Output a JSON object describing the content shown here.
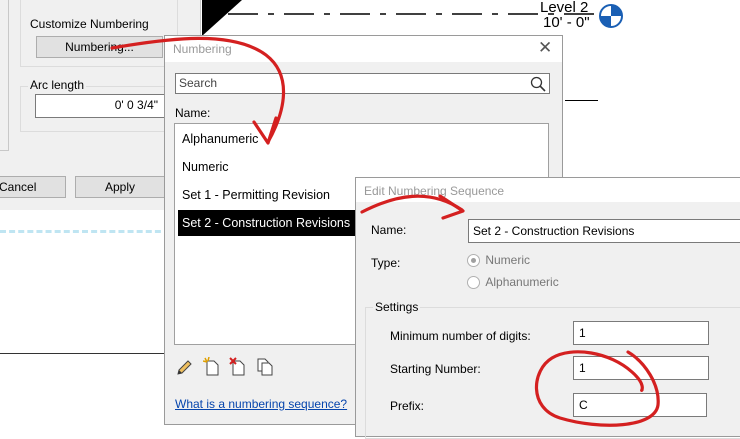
{
  "background_dialog": {
    "customize_numbering_label": "Customize Numbering",
    "numbering_button_label": "Numbering...",
    "arc_length_label": "Arc length",
    "arc_length_value": "0'  0 3/4\"",
    "cancel_label": "Cancel",
    "apply_label": "Apply"
  },
  "drawing": {
    "level_name": "Level 2",
    "level_elevation": "10' - 0\""
  },
  "numbering_dialog": {
    "title": "Numbering",
    "search_placeholder": "Search",
    "name_label": "Name:",
    "items": [
      {
        "label": "Alphanumeric"
      },
      {
        "label": "Numeric"
      },
      {
        "label": "Set 1 - Permitting Revision"
      },
      {
        "label": "Set 2 - Construction Revisions"
      }
    ],
    "selected_index": 3,
    "help_link": "What is a numbering sequence?"
  },
  "edit_dialog": {
    "title": "Edit Numbering Sequence",
    "name_label": "Name:",
    "name_value": "Set 2 - Construction Revisions",
    "type_label": "Type:",
    "type_options": [
      "Numeric",
      "Alphanumeric"
    ],
    "type_selected": "Numeric",
    "settings_label": "Settings",
    "min_digits_label": "Minimum number of digits:",
    "min_digits_value": "1",
    "starting_number_label": "Starting Number:",
    "starting_number_value": "1",
    "prefix_label": "Prefix:",
    "prefix_value": "C"
  },
  "annotation_color": "#d42020"
}
